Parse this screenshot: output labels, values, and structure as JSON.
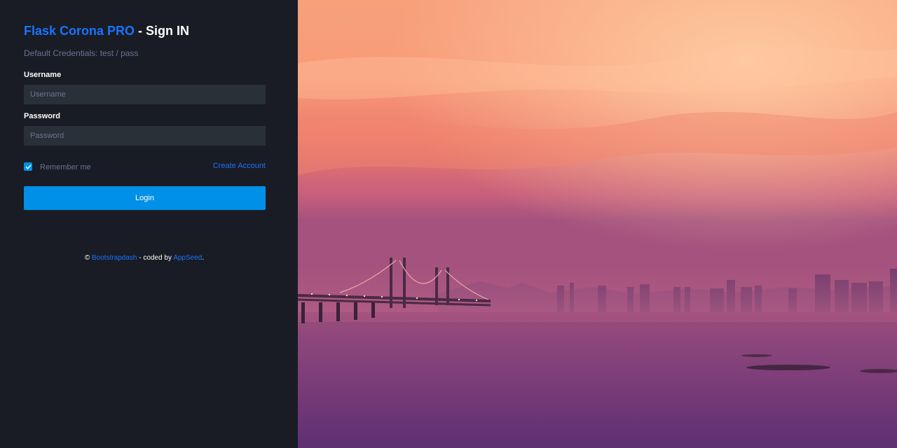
{
  "header": {
    "brand": "Flask Corona PRO",
    "separator": " - ",
    "title": "Sign IN",
    "subtitle": "Default Credentials: test / pass"
  },
  "form": {
    "username_label": "Username",
    "username_placeholder": "Username",
    "password_label": "Password",
    "password_placeholder": "Password",
    "remember_label": "Remember me",
    "remember_checked": true,
    "create_account_label": "Create Account",
    "login_label": "Login"
  },
  "footer": {
    "copyright": "©",
    "link1": "Bootstrapdash",
    "middle": " - coded by ",
    "link2": "AppSeed",
    "end": "."
  },
  "colors": {
    "panel_bg": "#191c24",
    "input_bg": "#2a3038",
    "accent": "#0090e7",
    "link": "#1a73ff",
    "muted": "#6c7293"
  },
  "background_image": {
    "icon": "sunset-bridge-cityscape-photo"
  }
}
